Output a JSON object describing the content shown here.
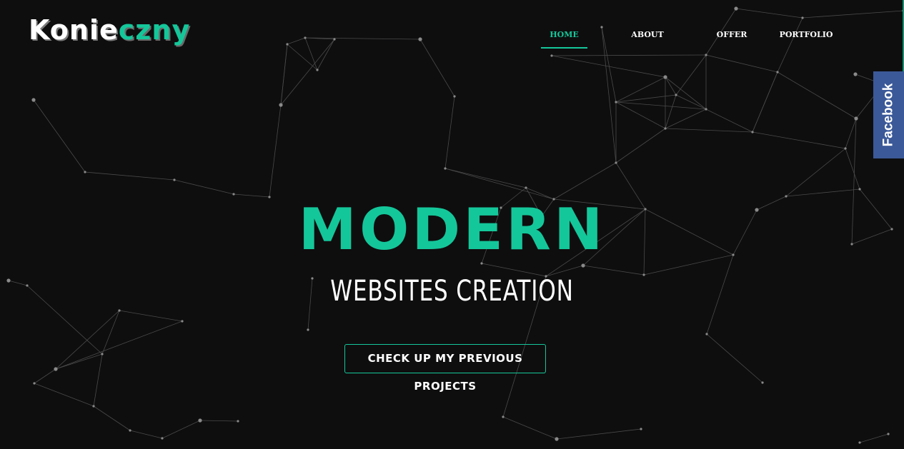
{
  "logo": {
    "part1": "Konie",
    "part2": "czny"
  },
  "nav": {
    "items": [
      {
        "label": "HOME",
        "active": true
      },
      {
        "label": "ABOUT",
        "active": false
      },
      {
        "label": "OFFER",
        "active": false
      },
      {
        "label": "PORTFOLIO",
        "active": false
      }
    ]
  },
  "social": {
    "facebook_label": "Facebook"
  },
  "hero": {
    "title": "MODERN",
    "subtitle": "WEBSITES CREATION",
    "cta_label": "CHECK UP MY PREVIOUS PROJECTS"
  },
  "colors": {
    "accent": "#14c79a",
    "background": "#0e0e0f",
    "facebook": "#3b5998"
  }
}
